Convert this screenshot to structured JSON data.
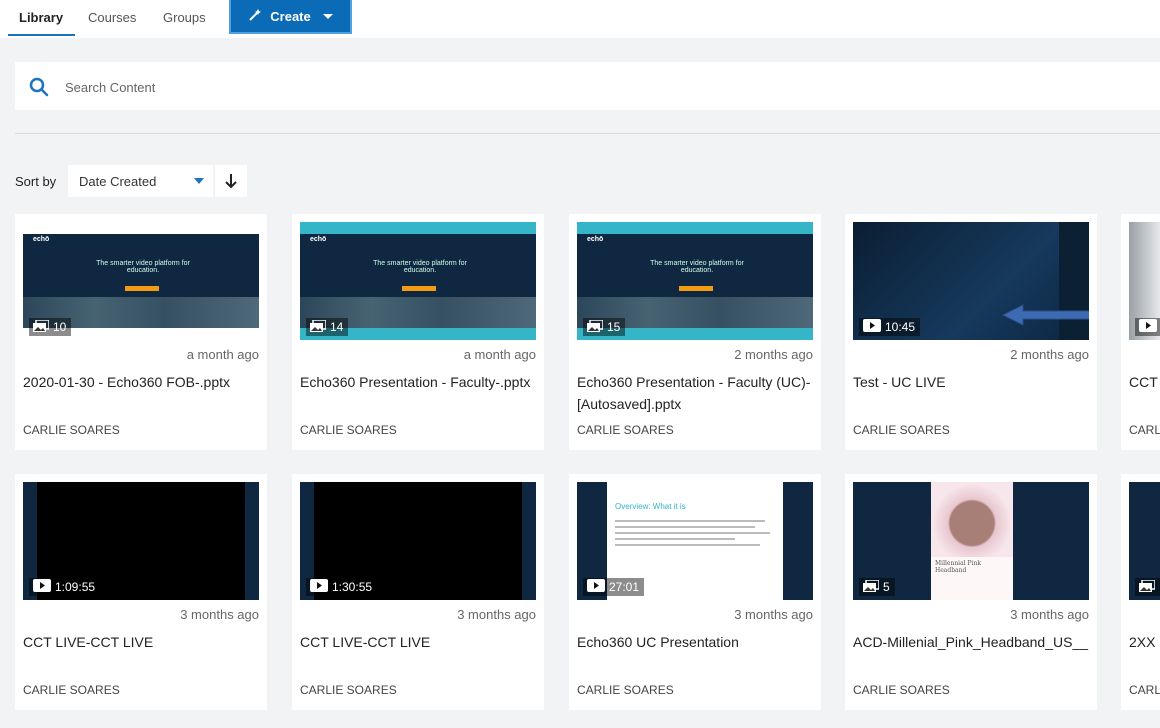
{
  "nav": {
    "tabs": [
      "Library",
      "Courses",
      "Groups"
    ],
    "create_label": "Create"
  },
  "search": {
    "placeholder": "Search Content"
  },
  "sort": {
    "label": "Sort by",
    "value": "Date Created"
  },
  "cards": [
    {
      "badge": "10",
      "badge_icon": "slides-icon",
      "ago": "a month ago",
      "title": "2020-01-30 - Echo360 FOB-.pptx",
      "author": "CARLIE SOARES"
    },
    {
      "badge": "14",
      "badge_icon": "slides-icon",
      "ago": "a month ago",
      "title": "Echo360 Presentation - Faculty-.pptx",
      "author": "CARLIE SOARES"
    },
    {
      "badge": "15",
      "badge_icon": "slides-icon",
      "ago": "2 months ago",
      "title": "Echo360 Presentation - Faculty (UC)- [Autosaved].pptx",
      "author": "CARLIE SOARES"
    },
    {
      "badge": "10:45",
      "badge_icon": "play-icon",
      "ago": "2 months ago",
      "title": "Test - UC LIVE",
      "author": "CARLIE SOARES"
    },
    {
      "badge": "",
      "badge_icon": "play-icon",
      "ago": "",
      "title": "CCT",
      "author": "CARL"
    },
    {
      "badge": "1:09:55",
      "badge_icon": "play-icon",
      "ago": "3 months ago",
      "title": "CCT LIVE-CCT LIVE",
      "author": "CARLIE SOARES"
    },
    {
      "badge": "1:30:55",
      "badge_icon": "play-icon",
      "ago": "3 months ago",
      "title": "CCT LIVE-CCT LIVE",
      "author": "CARLIE SOARES"
    },
    {
      "badge": "27:01",
      "badge_icon": "play-icon",
      "ago": "3 months ago",
      "title": "Echo360 UC Presentation",
      "author": "CARLIE SOARES"
    },
    {
      "badge": "5",
      "badge_icon": "slides-icon",
      "ago": "3 months ago",
      "title": "ACD-Millenial_Pink_Headband_US__",
      "author": "CARLIE SOARES"
    },
    {
      "badge": "",
      "badge_icon": "slides-icon",
      "ago": "",
      "title": "2XX",
      "author": "CARL"
    }
  ],
  "thumb_text": {
    "echo": "echō",
    "tagline": "The smarter video platform for education.",
    "overview": "Overview: What it is",
    "headband_caption": "Millennial Pink Headband"
  },
  "colors": {
    "accent": "#1e73be",
    "create_bg": "#0b6bb6",
    "thumb_bg": "#0f2740",
    "slide_band": "#34b5c8"
  }
}
